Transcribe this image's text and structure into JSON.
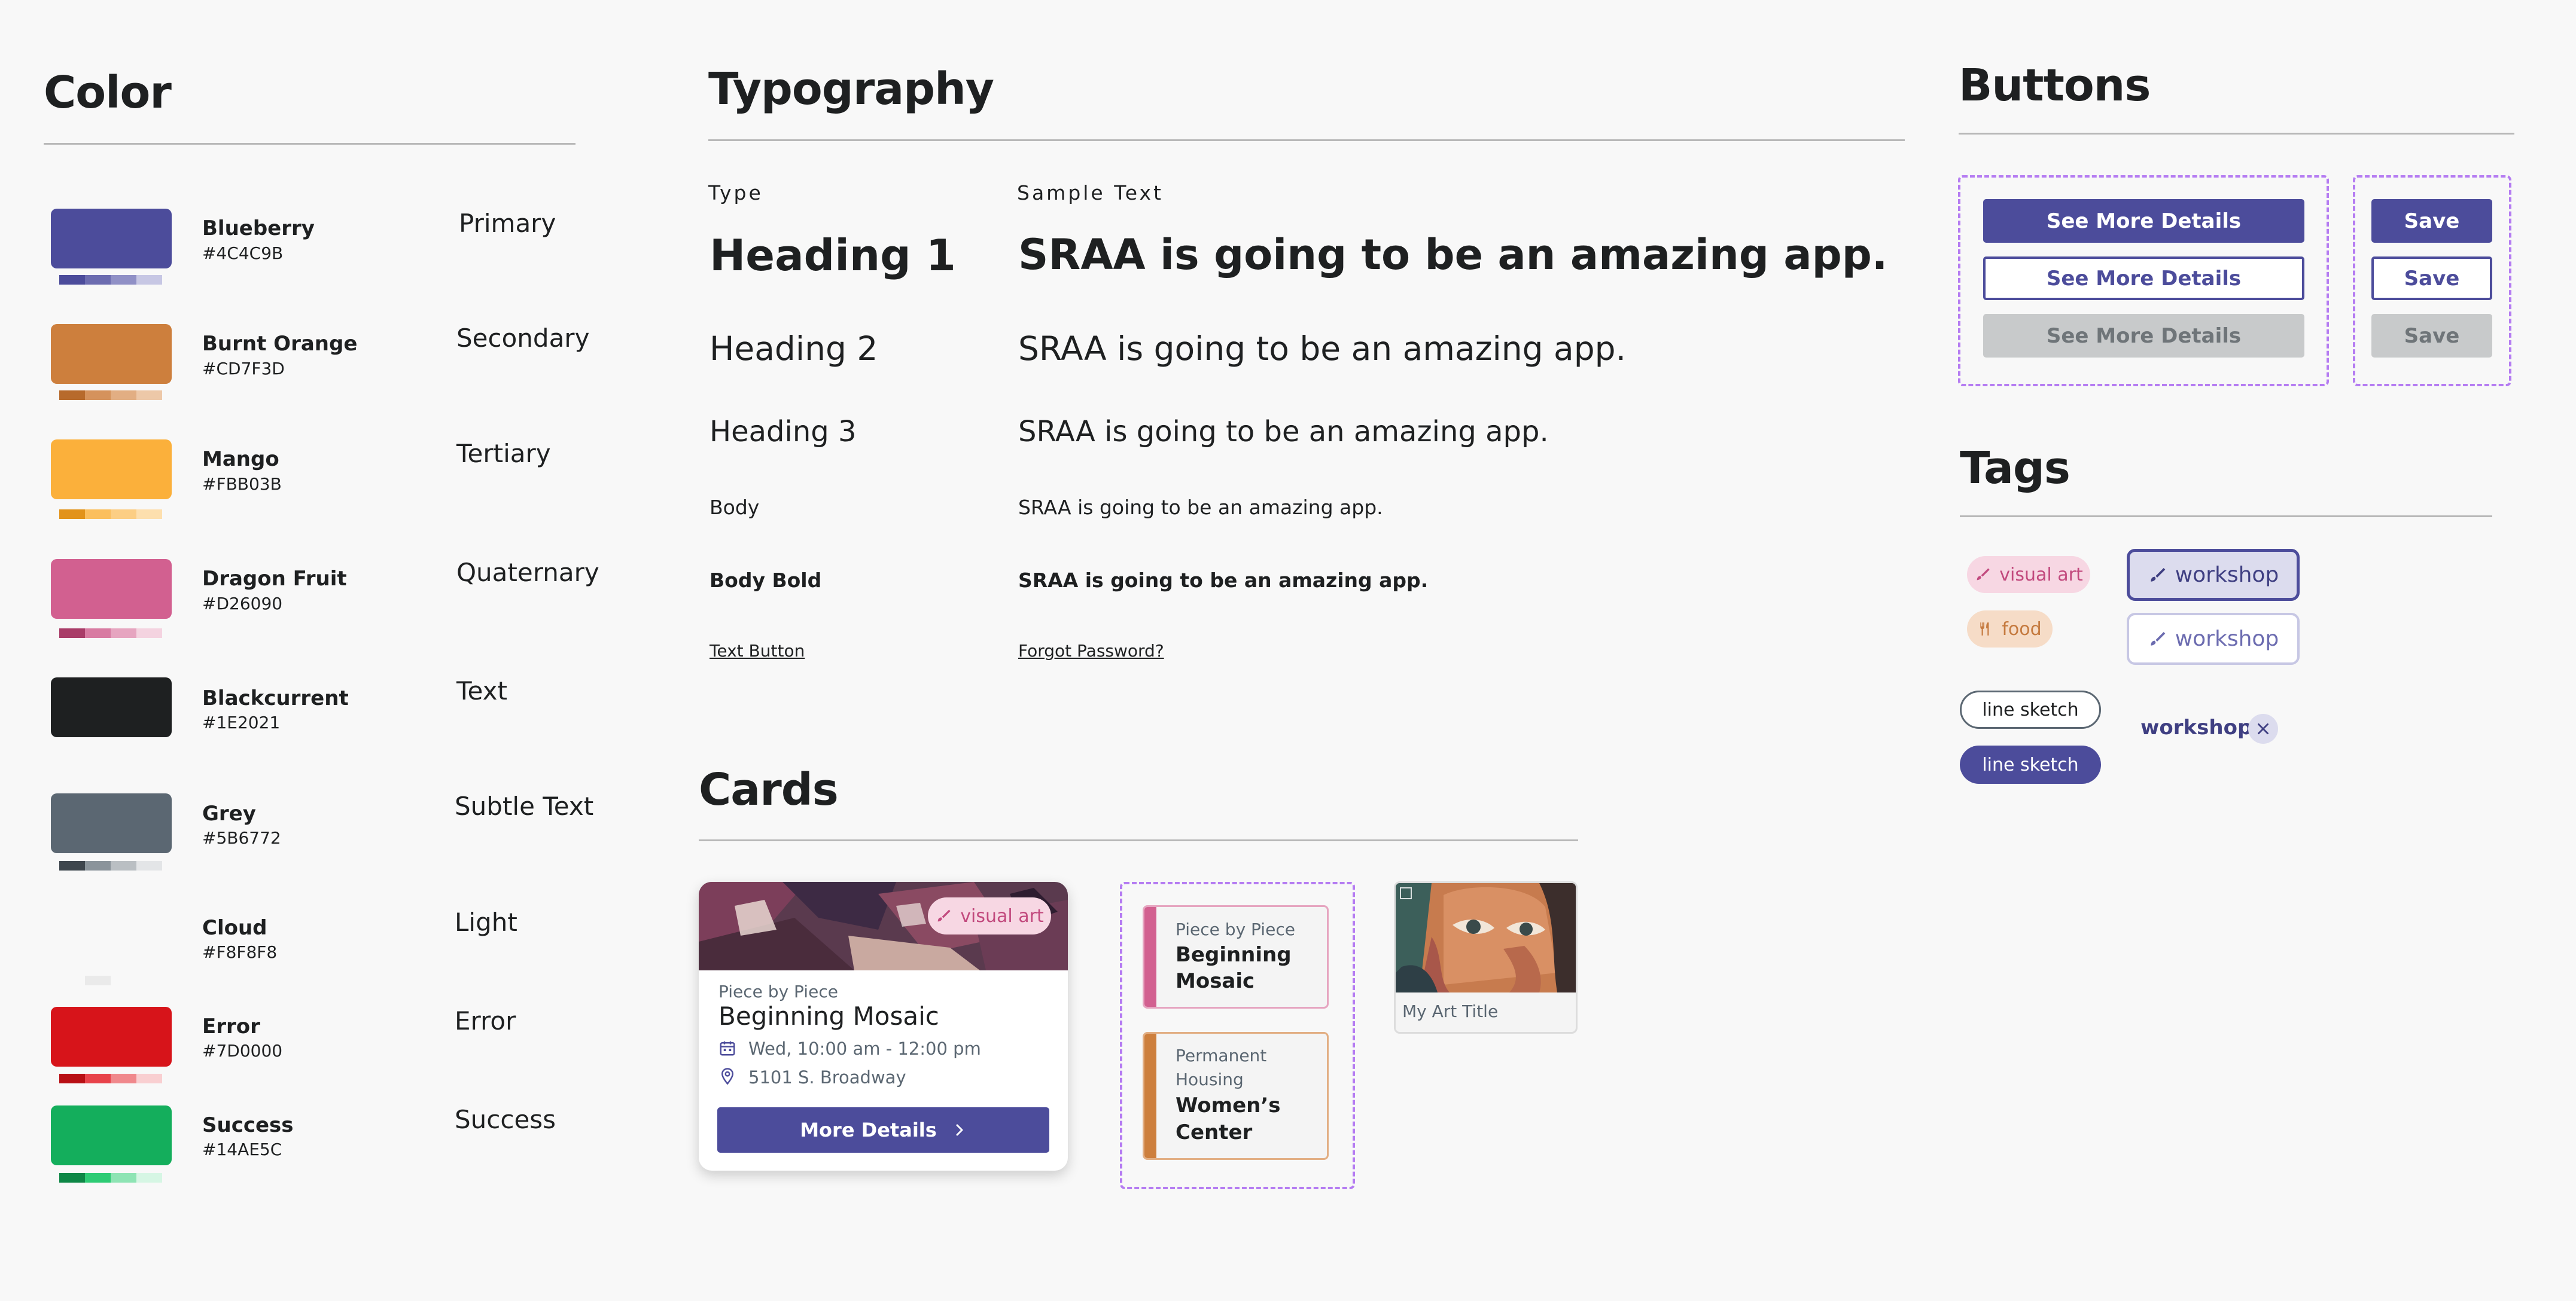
{
  "sections": {
    "color": "Color",
    "typography": "Typography",
    "buttons": "Buttons",
    "tags": "Tags",
    "cards": "Cards"
  },
  "colors": [
    {
      "name": "Blueberry",
      "hex": "#4C4C9B",
      "role": "Primary",
      "tints": [
        "#4C4C9B",
        "#6C6CB0",
        "#9090C6",
        "#C7C7E4"
      ]
    },
    {
      "name": "Burnt Orange",
      "hex": "#CD7F3D",
      "role": "Secondary",
      "tints": [
        "#B76A2C",
        "#D5925C",
        "#E2AE83",
        "#EDC8A8"
      ]
    },
    {
      "name": "Mango",
      "hex": "#FBB03B",
      "role": "Tertiary",
      "tints": [
        "#E2931A",
        "#FBBF5D",
        "#FCCE84",
        "#FDDFAE"
      ]
    },
    {
      "name": "Dragon Fruit",
      "hex": "#D26090",
      "role": "Quaternary",
      "tints": [
        "#A93C68",
        "#D87BA2",
        "#E6A5C0",
        "#F4D3E0"
      ]
    },
    {
      "name": "Blackcurrent",
      "hex": "#1E2021",
      "role": "Text",
      "tints": []
    },
    {
      "name": "Grey",
      "hex": "#5B6772",
      "role": "Subtle Text",
      "tints": [
        "#3E464D",
        "#8B949B",
        "#BABFC3",
        "#E3E5E7"
      ]
    },
    {
      "name": "Cloud",
      "hex": "#F8F8F8",
      "role": "Light",
      "tints": [
        "#F8F8F8",
        "#EAEAEA",
        "#F8F8F8",
        "#F8F8F8"
      ]
    },
    {
      "name": "Error",
      "hex": "#7D0000",
      "swatch": "#D7141A",
      "role": "Error",
      "tints": [
        "#B80F14",
        "#E8424A",
        "#F0888C",
        "#F9CFD1"
      ]
    },
    {
      "name": "Success",
      "hex": "#14AE5C",
      "role": "Success",
      "tints": [
        "#0E8746",
        "#2DCB74",
        "#8EE4B4",
        "#D6F6E4"
      ]
    }
  ],
  "typography": {
    "col_type": "Type",
    "col_sample": "Sample Text",
    "rows": [
      {
        "label": "Heading 1",
        "sample": "SRAA is going to be an amazing app."
      },
      {
        "label": "Heading 2",
        "sample": "SRAA is going to be an amazing app."
      },
      {
        "label": "Heading 3",
        "sample": "SRAA is going to be an amazing app."
      },
      {
        "label": "Body",
        "sample": "SRAA is going to be an amazing app."
      },
      {
        "label": "Body Bold",
        "sample": "SRAA is going to be an amazing app."
      },
      {
        "label": "Text Button",
        "sample": "Forgot Password?"
      }
    ]
  },
  "buttons": {
    "wide_primary": "See More Details",
    "wide_outline": "See More Details",
    "wide_disabled": "See More Details",
    "small_primary": "Save",
    "small_outline": "Save",
    "small_disabled": "Save"
  },
  "tags": {
    "visual_art": "visual art",
    "food": "food",
    "workshop_active": "workshop",
    "workshop_outline": "workshop",
    "line_sketch_outline": "line sketch",
    "line_sketch_filled": "line sketch",
    "workshop_removable": "workshop"
  },
  "cards": {
    "event": {
      "tag": "visual art",
      "subtitle": "Piece by Piece",
      "title": "Beginning Mosaic",
      "date": "Wed, 10:00 am - 12:00 pm",
      "location": "5101 S. Broadway",
      "button": "More Details"
    },
    "mini1": {
      "subtitle": "Piece by Piece",
      "title_line1": "Beginning",
      "title_line2": "Mosaic"
    },
    "mini2": {
      "subtitle_line1": "Permanent",
      "subtitle_line2": "Housing",
      "title_line1": "Women’s",
      "title_line2": "Center"
    },
    "art": {
      "title": "My Art Title"
    }
  }
}
